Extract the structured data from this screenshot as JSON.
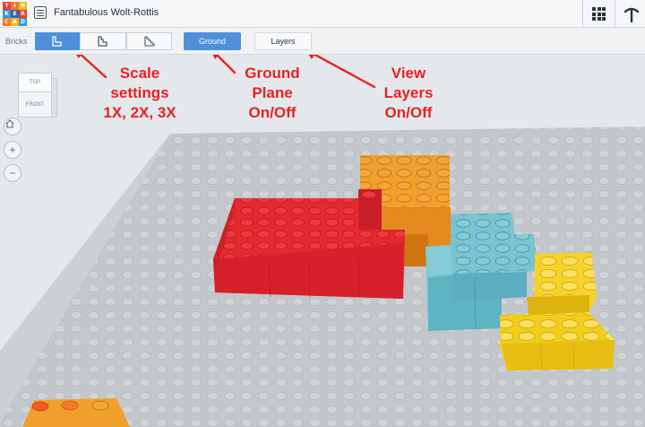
{
  "app": {
    "logo_letters": [
      "T",
      "I",
      "N",
      "K",
      "E",
      "R",
      "C",
      "A",
      "D"
    ],
    "logo_colors": [
      "#e1422f",
      "#ee7a24",
      "#f2b51e",
      "#2f9bd6",
      "#3a63ad",
      "#e1422f",
      "#ee7a24",
      "#f2b51e",
      "#2f9bd6"
    ],
    "title": "Fantabulous Wolt-Rottis",
    "grid_icon": "grid-icon",
    "pickaxe_icon": "pickaxe-icon"
  },
  "toolbar": {
    "bricks_label": "Bricks",
    "scale_buttons": [
      {
        "icon": "brick-scale-1x-icon",
        "active": true
      },
      {
        "icon": "brick-scale-2x-icon",
        "active": false
      },
      {
        "icon": "brick-scale-3x-icon",
        "active": false
      }
    ],
    "ground_label": "Ground",
    "layers_label": "Layers"
  },
  "viewcube": {
    "top_label": "TOP",
    "front_label": "FRONT"
  },
  "nav": {
    "home_icon": "home-icon",
    "zoom_in": "+",
    "zoom_out": "−"
  },
  "annotations": {
    "scale": [
      "Scale",
      "settings",
      "1X, 2X, 3X"
    ],
    "ground": [
      "Ground",
      "Plane",
      "On/Off"
    ],
    "layers": [
      "View",
      "Layers",
      "On/Off"
    ]
  },
  "colors": {
    "accent": "#4f90dc",
    "annotation": "#e8221e",
    "baseplate": "#c3c7cb",
    "brick_red": "#d6202a",
    "brick_orange": "#e58a1f",
    "brick_teal": "#5fb4c4",
    "brick_yellow": "#f3cd1c"
  }
}
